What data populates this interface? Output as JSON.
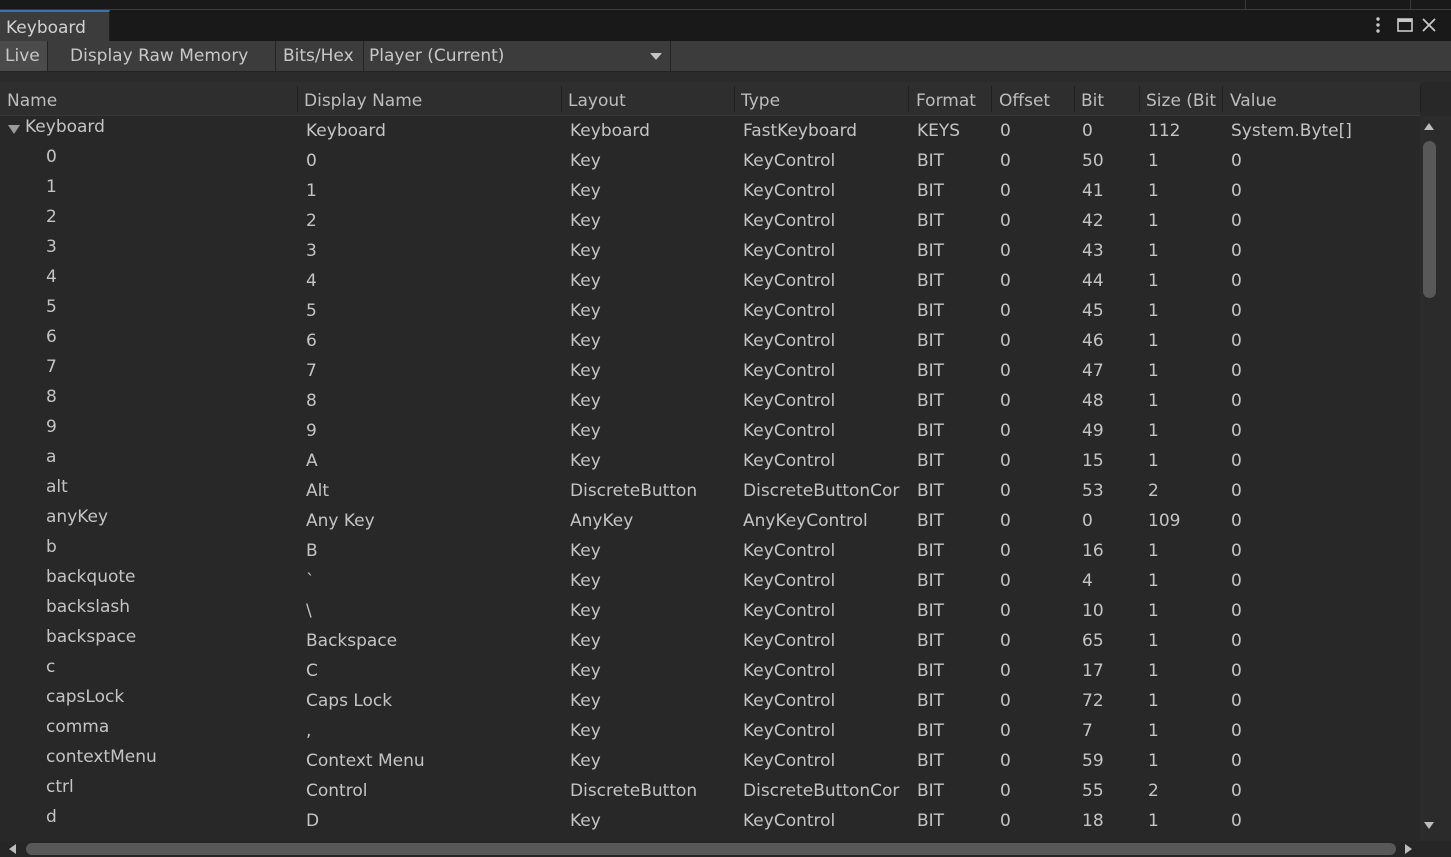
{
  "window": {
    "tab_title": "Keyboard",
    "menu_icon": "kebab-menu-icon",
    "maximize_icon": "maximize-icon",
    "close_icon": "close-icon"
  },
  "toolbar": {
    "live_label": "Live",
    "raw_memory_label": "Display Raw Memory",
    "bits_hex_label": "Bits/Hex",
    "player_selected": "Player (Current)"
  },
  "columns": [
    "Name",
    "Display Name",
    "Layout",
    "Type",
    "Format",
    "Offset",
    "Bit",
    "Size (Bit",
    "Value"
  ],
  "rows": [
    {
      "name": "Keyboard",
      "display": "Keyboard",
      "layout": "Keyboard",
      "type": "FastKeyboard",
      "format": "KEYS",
      "offset": "0",
      "bit": "0",
      "size": "112",
      "value": "System.Byte[]",
      "expanded": true
    },
    {
      "name": "0",
      "display": "0",
      "layout": "Key",
      "type": "KeyControl",
      "format": "BIT",
      "offset": "0",
      "bit": "50",
      "size": "1",
      "value": "0"
    },
    {
      "name": "1",
      "display": "1",
      "layout": "Key",
      "type": "KeyControl",
      "format": "BIT",
      "offset": "0",
      "bit": "41",
      "size": "1",
      "value": "0"
    },
    {
      "name": "2",
      "display": "2",
      "layout": "Key",
      "type": "KeyControl",
      "format": "BIT",
      "offset": "0",
      "bit": "42",
      "size": "1",
      "value": "0"
    },
    {
      "name": "3",
      "display": "3",
      "layout": "Key",
      "type": "KeyControl",
      "format": "BIT",
      "offset": "0",
      "bit": "43",
      "size": "1",
      "value": "0"
    },
    {
      "name": "4",
      "display": "4",
      "layout": "Key",
      "type": "KeyControl",
      "format": "BIT",
      "offset": "0",
      "bit": "44",
      "size": "1",
      "value": "0"
    },
    {
      "name": "5",
      "display": "5",
      "layout": "Key",
      "type": "KeyControl",
      "format": "BIT",
      "offset": "0",
      "bit": "45",
      "size": "1",
      "value": "0"
    },
    {
      "name": "6",
      "display": "6",
      "layout": "Key",
      "type": "KeyControl",
      "format": "BIT",
      "offset": "0",
      "bit": "46",
      "size": "1",
      "value": "0"
    },
    {
      "name": "7",
      "display": "7",
      "layout": "Key",
      "type": "KeyControl",
      "format": "BIT",
      "offset": "0",
      "bit": "47",
      "size": "1",
      "value": "0"
    },
    {
      "name": "8",
      "display": "8",
      "layout": "Key",
      "type": "KeyControl",
      "format": "BIT",
      "offset": "0",
      "bit": "48",
      "size": "1",
      "value": "0"
    },
    {
      "name": "9",
      "display": "9",
      "layout": "Key",
      "type": "KeyControl",
      "format": "BIT",
      "offset": "0",
      "bit": "49",
      "size": "1",
      "value": "0"
    },
    {
      "name": "a",
      "display": "A",
      "layout": "Key",
      "type": "KeyControl",
      "format": "BIT",
      "offset": "0",
      "bit": "15",
      "size": "1",
      "value": "0"
    },
    {
      "name": "alt",
      "display": "Alt",
      "layout": "DiscreteButton",
      "type": "DiscreteButtonCor",
      "format": "BIT",
      "offset": "0",
      "bit": "53",
      "size": "2",
      "value": "0"
    },
    {
      "name": "anyKey",
      "display": "Any Key",
      "layout": "AnyKey",
      "type": "AnyKeyControl",
      "format": "BIT",
      "offset": "0",
      "bit": "0",
      "size": "109",
      "value": "0"
    },
    {
      "name": "b",
      "display": "B",
      "layout": "Key",
      "type": "KeyControl",
      "format": "BIT",
      "offset": "0",
      "bit": "16",
      "size": "1",
      "value": "0"
    },
    {
      "name": "backquote",
      "display": "`",
      "layout": "Key",
      "type": "KeyControl",
      "format": "BIT",
      "offset": "0",
      "bit": "4",
      "size": "1",
      "value": "0"
    },
    {
      "name": "backslash",
      "display": "\\",
      "layout": "Key",
      "type": "KeyControl",
      "format": "BIT",
      "offset": "0",
      "bit": "10",
      "size": "1",
      "value": "0"
    },
    {
      "name": "backspace",
      "display": "Backspace",
      "layout": "Key",
      "type": "KeyControl",
      "format": "BIT",
      "offset": "0",
      "bit": "65",
      "size": "1",
      "value": "0"
    },
    {
      "name": "c",
      "display": "C",
      "layout": "Key",
      "type": "KeyControl",
      "format": "BIT",
      "offset": "0",
      "bit": "17",
      "size": "1",
      "value": "0"
    },
    {
      "name": "capsLock",
      "display": "Caps Lock",
      "layout": "Key",
      "type": "KeyControl",
      "format": "BIT",
      "offset": "0",
      "bit": "72",
      "size": "1",
      "value": "0"
    },
    {
      "name": "comma",
      "display": ",",
      "layout": "Key",
      "type": "KeyControl",
      "format": "BIT",
      "offset": "0",
      "bit": "7",
      "size": "1",
      "value": "0"
    },
    {
      "name": "contextMenu",
      "display": "Context Menu",
      "layout": "Key",
      "type": "KeyControl",
      "format": "BIT",
      "offset": "0",
      "bit": "59",
      "size": "1",
      "value": "0"
    },
    {
      "name": "ctrl",
      "display": "Control",
      "layout": "DiscreteButton",
      "type": "DiscreteButtonCor",
      "format": "BIT",
      "offset": "0",
      "bit": "55",
      "size": "2",
      "value": "0"
    },
    {
      "name": "d",
      "display": "D",
      "layout": "Key",
      "type": "KeyControl",
      "format": "BIT",
      "offset": "0",
      "bit": "18",
      "size": "1",
      "value": "0"
    }
  ]
}
